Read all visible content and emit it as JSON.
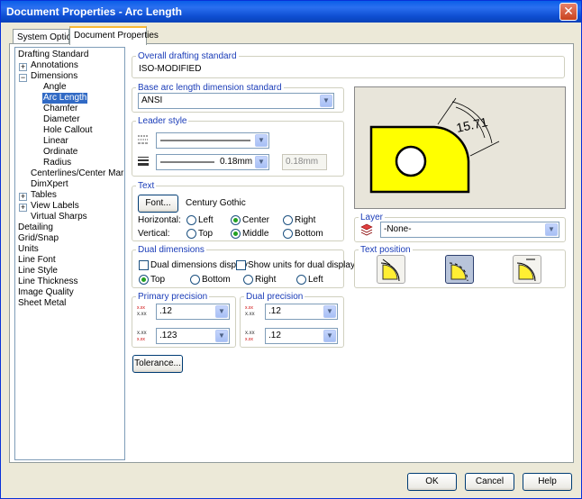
{
  "window": {
    "title": "Document Properties - Arc Length"
  },
  "tabs": [
    {
      "label": "System Options"
    },
    {
      "label": "Document Properties"
    }
  ],
  "tree": {
    "items": [
      {
        "label": "Drafting Standard"
      },
      {
        "label": "Annotations"
      },
      {
        "label": "Dimensions"
      },
      {
        "label": "Angle"
      },
      {
        "label": "Arc Length"
      },
      {
        "label": "Chamfer"
      },
      {
        "label": "Diameter"
      },
      {
        "label": "Hole Callout"
      },
      {
        "label": "Linear"
      },
      {
        "label": "Ordinate"
      },
      {
        "label": "Radius"
      },
      {
        "label": "Centerlines/Center Marks"
      },
      {
        "label": "DimXpert"
      },
      {
        "label": "Tables"
      },
      {
        "label": "View Labels"
      },
      {
        "label": "Virtual Sharps"
      },
      {
        "label": "Detailing"
      },
      {
        "label": "Grid/Snap"
      },
      {
        "label": "Units"
      },
      {
        "label": "Line Font"
      },
      {
        "label": "Line Style"
      },
      {
        "label": "Line Thickness"
      },
      {
        "label": "Image Quality"
      },
      {
        "label": "Sheet Metal"
      }
    ]
  },
  "overall": {
    "label": "Overall drafting standard",
    "value": "ISO-MODIFIED"
  },
  "base": {
    "label": "Base arc length dimension standard",
    "value": "ANSI"
  },
  "leader": {
    "label": "Leader style",
    "thickness": "0.18mm",
    "custom": "0.18mm"
  },
  "text": {
    "label": "Text",
    "font_button": "Font...",
    "font_name": "Century Gothic",
    "horizontal_label": "Horizontal:",
    "vertical_label": "Vertical:",
    "h_options": [
      "Left",
      "Center",
      "Right"
    ],
    "h_selected": "Center",
    "v_options": [
      "Top",
      "Middle",
      "Bottom"
    ],
    "v_selected": "Middle"
  },
  "dual": {
    "label": "Dual dimensions",
    "display_label": "Dual dimensions display",
    "display_checked": false,
    "show_units_label": "Show units for dual display",
    "show_units_checked": false,
    "positions": [
      "Top",
      "Bottom",
      "Right",
      "Left"
    ],
    "selected": "Top"
  },
  "primary_precision": {
    "label": "Primary precision",
    "value1": ".12",
    "value2": ".123"
  },
  "dual_precision": {
    "label": "Dual precision",
    "value1": ".12",
    "value2": ".12"
  },
  "tolerance_button": "Tolerance...",
  "preview": {
    "dimension_text": "15.71"
  },
  "layer": {
    "label": "Layer",
    "value": "-None-"
  },
  "text_position": {
    "label": "Text position",
    "selected_index": 1
  },
  "footer": {
    "ok": "OK",
    "cancel": "Cancel",
    "help": "Help"
  },
  "colors": {
    "title_bar": "#0a5fe8",
    "dialog_bg": "#ece9d8",
    "group_label": "#1a3cb8",
    "part_fill": "#ffff00",
    "selection": "#316ac5"
  }
}
